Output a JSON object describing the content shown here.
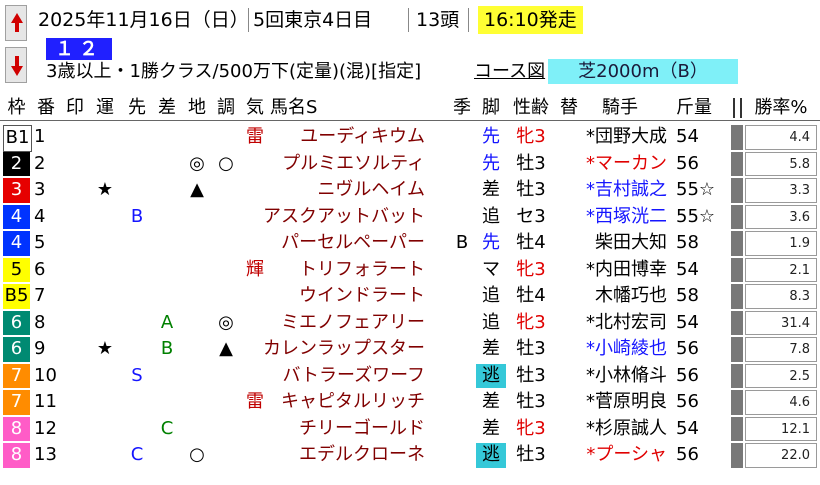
{
  "header": {
    "date": "2025年11月16日（日）",
    "meeting": "5回東京4日目",
    "runners": "13頭",
    "start_time": "16:10発走",
    "race_no": "１２Ｒ",
    "conditions": "3歳以上・1勝クラス/500万下(定量)(混)[指定]",
    "course_link": "コース図",
    "course": "芝2000m（B）"
  },
  "columns": {
    "waku": "枠",
    "num": "番",
    "mark": "印",
    "un": "運",
    "saki": "先",
    "sa": "差",
    "chi": "地",
    "cho": "調",
    "ki": "気",
    "name": "馬名S",
    "season": "季",
    "kyaku": "脚",
    "sexage": "性齢",
    "kawari": "替",
    "jockey": "騎手",
    "kinryo": "斤量",
    "rate": "勝率%"
  },
  "colors": {
    "waku1": "#ffffff",
    "waku2": "#000000",
    "waku3": "#e60000",
    "waku4": "#0033ff",
    "waku5": "#ffff00",
    "waku6": "#008a72",
    "waku7": "#ff8c00",
    "waku8": "#ff5cc7",
    "start_time_bg": "#ffff33",
    "race_no_bg": "#2020ff",
    "course_bg": "#7ff0f8"
  },
  "rows": [
    {
      "waku": "B1",
      "num": "1",
      "mark": "",
      "un": "",
      "saki": "",
      "sa": "",
      "chi": "",
      "cho": "",
      "ki": "雷",
      "name": "ユーディキウム",
      "season": "",
      "kyaku": "先",
      "sexage": "牝3",
      "jockey": "*団野大成",
      "kinryo": "54",
      "rate": "4.4"
    },
    {
      "waku": "2",
      "num": "2",
      "mark": "",
      "un": "",
      "saki": "",
      "sa": "",
      "chi": "◎",
      "cho": "○",
      "ki": "",
      "name": "プルミエソルティ",
      "season": "",
      "kyaku": "先",
      "sexage": "牡3",
      "jockey": "*マーカン",
      "kinryo": "56",
      "rate": "5.8"
    },
    {
      "waku": "3",
      "num": "3",
      "mark": "",
      "un": "★",
      "saki": "",
      "sa": "",
      "chi": "▲",
      "cho": "",
      "ki": "",
      "name": "ニヴルヘイム",
      "season": "",
      "kyaku": "差",
      "sexage": "牡3",
      "jockey": "*吉村誠之",
      "kinryo": "55☆",
      "rate": "3.3"
    },
    {
      "waku": "4",
      "num": "4",
      "mark": "",
      "un": "",
      "saki": "B",
      "sa": "",
      "chi": "",
      "cho": "",
      "ki": "",
      "name": "アスクアットバット",
      "season": "",
      "kyaku": "追",
      "sexage": "セ3",
      "jockey": "*西塚洸二",
      "kinryo": "55☆",
      "rate": "3.6"
    },
    {
      "waku": "4",
      "num": "5",
      "mark": "",
      "un": "",
      "saki": "",
      "sa": "",
      "chi": "",
      "cho": "",
      "ki": "",
      "name": "パーセルペーパー",
      "season": "B",
      "kyaku": "先",
      "sexage": "牡4",
      "jockey": "柴田大知",
      "kinryo": "58",
      "rate": "1.9"
    },
    {
      "waku": "5",
      "num": "6",
      "mark": "",
      "un": "",
      "saki": "",
      "sa": "",
      "chi": "",
      "cho": "",
      "ki": "輝",
      "name": "トリフォラート",
      "season": "",
      "kyaku": "マ",
      "sexage": "牝3",
      "jockey": "*内田博幸",
      "kinryo": "54",
      "rate": "2.1"
    },
    {
      "waku": "B5",
      "num": "7",
      "mark": "",
      "un": "",
      "saki": "",
      "sa": "",
      "chi": "",
      "cho": "",
      "ki": "",
      "name": "ウインドラート",
      "season": "",
      "kyaku": "追",
      "sexage": "牡4",
      "jockey": "木幡巧也",
      "kinryo": "58",
      "rate": "8.3"
    },
    {
      "waku": "6",
      "num": "8",
      "mark": "",
      "un": "",
      "saki": "",
      "sa": "A",
      "chi": "",
      "cho": "◎",
      "ki": "",
      "name": "ミエノフェアリー",
      "season": "",
      "kyaku": "追",
      "sexage": "牝3",
      "jockey": "*北村宏司",
      "kinryo": "54",
      "rate": "31.4"
    },
    {
      "waku": "6",
      "num": "9",
      "mark": "",
      "un": "★",
      "saki": "",
      "sa": "B",
      "chi": "",
      "cho": "▲",
      "ki": "",
      "name": "カレンラップスター",
      "season": "",
      "kyaku": "差",
      "sexage": "牡3",
      "jockey": "*小崎綾也",
      "kinryo": "56",
      "rate": "7.8"
    },
    {
      "waku": "7",
      "num": "10",
      "mark": "",
      "un": "",
      "saki": "S",
      "sa": "",
      "chi": "",
      "cho": "",
      "ki": "",
      "name": "バトラーズワーフ",
      "season": "",
      "kyaku": "逃",
      "sexage": "牡3",
      "jockey": "*小林脩斗",
      "kinryo": "56",
      "rate": "2.5"
    },
    {
      "waku": "7",
      "num": "11",
      "mark": "",
      "un": "",
      "saki": "",
      "sa": "",
      "chi": "",
      "cho": "",
      "ki": "雷",
      "name": "キャピタルリッチ",
      "season": "",
      "kyaku": "差",
      "sexage": "牡3",
      "jockey": "*菅原明良",
      "kinryo": "56",
      "rate": "4.6"
    },
    {
      "waku": "8",
      "num": "12",
      "mark": "",
      "un": "",
      "saki": "",
      "sa": "C",
      "chi": "",
      "cho": "",
      "ki": "",
      "name": "チリーゴールド",
      "season": "",
      "kyaku": "差",
      "sexage": "牝3",
      "jockey": "*杉原誠人",
      "kinryo": "54",
      "rate": "12.1"
    },
    {
      "waku": "8",
      "num": "13",
      "mark": "",
      "un": "",
      "saki": "C",
      "sa": "",
      "chi": "○",
      "cho": "",
      "ki": "",
      "name": "エデルクローネ",
      "season": "",
      "kyaku": "逃",
      "sexage": "牡3",
      "jockey": "*プーシャ",
      "kinryo": "56",
      "rate": "22.0"
    }
  ]
}
